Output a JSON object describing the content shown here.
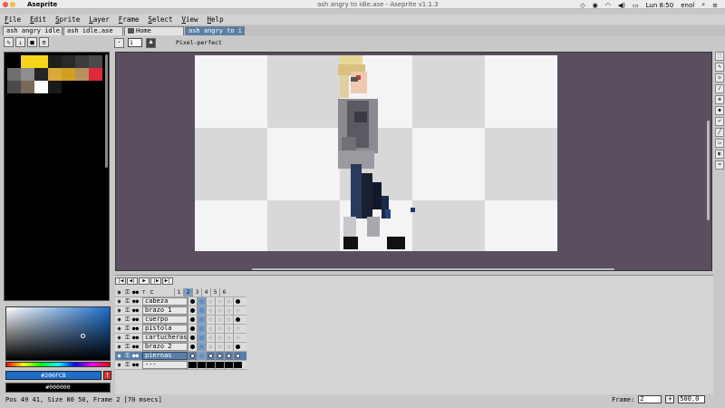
{
  "os_menubar": {
    "app_name": "Aseprite",
    "window_title": "ash angry to idle.ase - Aseprite v1.1.3",
    "clock": "Lun 8:50",
    "user": "enol"
  },
  "app_menu": [
    {
      "key": "F",
      "rest": "ile"
    },
    {
      "key": "E",
      "rest": "dit"
    },
    {
      "key": "S",
      "rest": "prite"
    },
    {
      "key": "L",
      "rest": "ayer"
    },
    {
      "key": "F",
      "rest": "rame"
    },
    {
      "key": "S",
      "rest": "elect"
    },
    {
      "key": "V",
      "rest": "iew"
    },
    {
      "key": "H",
      "rest": "elp"
    }
  ],
  "tabs": [
    {
      "label": "ash angry idle."
    },
    {
      "label": "ash idle.ase"
    },
    {
      "label": "Home"
    },
    {
      "label": "ash angry to i"
    }
  ],
  "context_bar": {
    "brush_size": "1",
    "pixel_perfect_label": "Pixel-perfect"
  },
  "palette": {
    "colors": [
      "#000000",
      "#f5d51b",
      "#f5d51b",
      "#1e1e1e",
      "#2a2a2a",
      "#3c3c3c",
      "#4a4a4a",
      "#6e6e6e",
      "#8e8e8e",
      "#262626",
      "#d8a838",
      "#d0a020",
      "#b89060",
      "#e0283a",
      "#4a4a4a",
      "#7a6858",
      "#ffffff",
      "#1a1a1a"
    ]
  },
  "color_bar": {
    "fg_hex": "#206FCB",
    "bg_hex": "#000000",
    "fg_color": "#1d6ecb",
    "warn_symbol": "!"
  },
  "timeline": {
    "controls": [
      "|◀",
      "◀|",
      "▶",
      "|▶",
      "▶|"
    ],
    "frame_numbers": [
      "1",
      "2",
      "3",
      "4",
      "5",
      "6"
    ],
    "layers": [
      {
        "name": "cabeza",
        "cels": [
          "full",
          "sel",
          "empty",
          "empty",
          "empty",
          "full"
        ],
        "active": false
      },
      {
        "name": "brazo 1",
        "cels": [
          "full",
          "sel",
          "empty",
          "empty",
          "empty",
          "empty"
        ],
        "active": false
      },
      {
        "name": "cuerpo",
        "cels": [
          "full",
          "sel",
          "empty",
          "empty",
          "empty",
          "full"
        ],
        "active": false
      },
      {
        "name": "pistola",
        "cels": [
          "full",
          "sel",
          "empty",
          "empty",
          "empty",
          "empty"
        ],
        "active": false
      },
      {
        "name": "cartucheras",
        "cels": [
          "full",
          "sel",
          "empty",
          "empty",
          "empty",
          "empty"
        ],
        "active": false
      },
      {
        "name": "brazo 2",
        "cels": [
          "full",
          "sel",
          "empty",
          "empty",
          "empty",
          "full"
        ],
        "active": false
      },
      {
        "name": "piernas",
        "cels": [
          "white",
          "sel",
          "white",
          "white",
          "white",
          "white"
        ],
        "active": true
      },
      {
        "name": "---",
        "cels": [
          "black",
          "black",
          "black",
          "black",
          "black",
          "black"
        ],
        "active": false
      }
    ]
  },
  "status": {
    "text": "Pos 49 41, Size 80 50, Frame 2 [70 msecs]",
    "frame_label": "Frame:",
    "frame_value": "2",
    "plus": "+",
    "zoom": "500.0"
  }
}
